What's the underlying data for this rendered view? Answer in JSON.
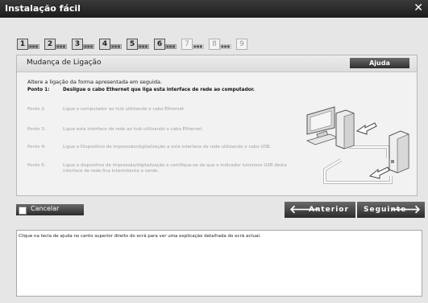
{
  "window": {
    "title": "Instalação fácil",
    "close_glyph": "✕"
  },
  "steps": [
    {
      "num": "1",
      "sub": "■■■",
      "state": "done"
    },
    {
      "num": "2",
      "sub": "■■■",
      "state": "done"
    },
    {
      "num": "3",
      "sub": "■■■",
      "state": "done"
    },
    {
      "num": "4",
      "sub": "■■■",
      "state": "done"
    },
    {
      "num": "5",
      "sub": "■■■",
      "state": "done"
    },
    {
      "num": "6",
      "sub": "■■■",
      "state": "done"
    },
    {
      "num": "7",
      "sub": "■■■",
      "state": "inactive"
    },
    {
      "num": "8",
      "sub": "■■■",
      "state": "inactive"
    },
    {
      "num": "9",
      "sub": "",
      "state": "inactive"
    }
  ],
  "panel": {
    "title": "Mudança de Ligação",
    "help_label": "Ajuda",
    "intro": "Altere a ligação da forma apresentada em seguida.",
    "points": [
      {
        "label": "Ponto 1:",
        "text": "Desligue o cabo Ethernet que liga esta interface de rede ao computador.",
        "active": true
      },
      {
        "label": "Ponto 2:",
        "text": "Ligue o computador ao hub utilizando o cabo Ethernet.",
        "active": false
      },
      {
        "label": "Ponto 3:",
        "text": "Ligue esta interface de rede ao hub utilizando o cabo Ethernet.",
        "active": false
      },
      {
        "label": "Ponto 4:",
        "text": "Ligue a Dispositivo de impressão/digitalização a esta interface de rede utilizando o cabo USB.",
        "active": false
      },
      {
        "label": "Ponto 5:",
        "text": "Ligue o dispositivo de impressão/digitalização e certifique-se de que o indicador luminoso USB desta interface de rede fica intermitente e verde.",
        "active": false
      }
    ],
    "illustration_icon": "computer-to-network-device-icon"
  },
  "buttons": {
    "cancel": "Cancelar",
    "previous": "Anterior",
    "previous_icon": "arrow-left-icon",
    "next": "Seguinte",
    "next_icon": "arrow-right-icon"
  },
  "info": {
    "text": "Clique na tecla de ajuda no canto superior direito do ecrã para ver uma explicação detalhada do ecrã actual."
  },
  "colors": {
    "titlebar": "#2a2a2a",
    "button_dark": "#3a3a3a",
    "background": "#e6e6e6"
  }
}
